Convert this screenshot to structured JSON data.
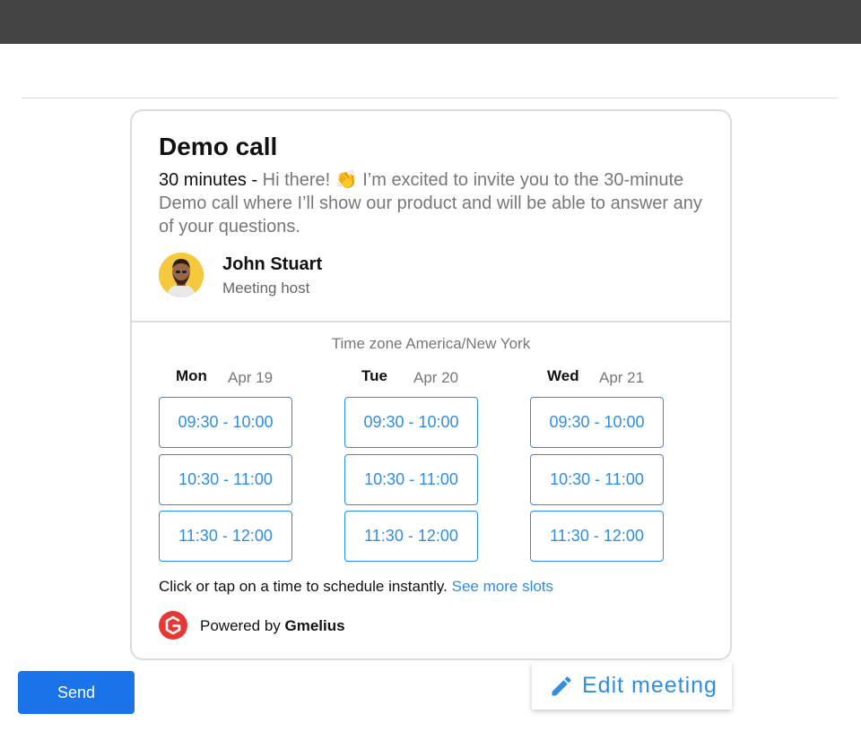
{
  "meeting": {
    "title": "Demo call",
    "duration": "30 minutes -",
    "description": " Hi there! 👏 I’m excited to invite you to the 30-minute Demo call where I’ll show our product and will be able to answer any of your questions.",
    "host": {
      "name": "John Stuart",
      "role": "Meeting host"
    }
  },
  "schedule": {
    "timezone": "Time zone America/New York",
    "days": [
      {
        "name": "Mon",
        "date": "Apr 19",
        "slots": [
          "09:30 - 10:00",
          "10:30 - 11:00",
          "11:30 - 12:00"
        ]
      },
      {
        "name": "Tue",
        "date": "Apr 20",
        "slots": [
          "09:30 - 10:00",
          "10:30 - 11:00",
          "11:30 - 12:00"
        ]
      },
      {
        "name": "Wed",
        "date": "Apr 21",
        "slots": [
          "09:30 - 10:00",
          "10:30 - 11:00",
          "11:30 - 12:00"
        ]
      }
    ],
    "hint": "Click or tap on a time to schedule instantly.",
    "more_link": "See more slots"
  },
  "powered": {
    "prefix": "Powered by ",
    "brand": "Gmelius"
  },
  "actions": {
    "send_label": "Send",
    "edit_label": "Edit meeting"
  },
  "colors": {
    "accent": "#2f8de4",
    "send": "#1a73e8",
    "brand_red": "#e53935",
    "topbar": "#444444"
  }
}
